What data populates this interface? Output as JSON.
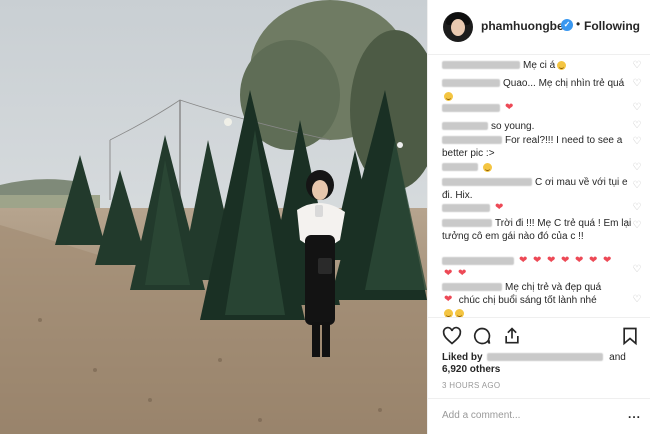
{
  "post": {
    "username": "phamhuongbee",
    "follow_label": "Following",
    "separator": "•"
  },
  "comments": [
    {
      "text": "Mẹ ci á",
      "emoji": "grinning-face"
    },
    {
      "text": "Quao... Mẹ chị nhìn trẻ quá",
      "emoji": "smiling-face"
    },
    {
      "text": "",
      "emoji": "red-heart"
    },
    {
      "text": "so young."
    },
    {
      "text": "For real?!!! I need to see a better pic :>"
    },
    {
      "text": "",
      "emoji": "smiling-face"
    },
    {
      "text": "C ơi mau về với tụi e đi. Hix."
    },
    {
      "text": "",
      "emoji": "red-heart"
    },
    {
      "text": "Trời đi !!! Mẹ C trẻ quá ! Em lại tưởng cô em gái nào đó của c !!"
    },
    {
      "text": "",
      "emoji": "red-heart x7"
    },
    {
      "text": "Mẹ chị trẻ và đẹp quá",
      "line2": "chúc chị buổi sáng tốt lành nhé"
    }
  ],
  "actions": {
    "liked_by_prefix": "Liked by",
    "liked_by_and": "and",
    "likes_count": "6,920 others",
    "time_ago": "3 HOURS AGO",
    "add_comment_placeholder": "Add a comment...",
    "more_label": "..."
  },
  "colors": {
    "accent_blue": "#3897f0",
    "heart_red": "#ed4956",
    "border": "#efefef",
    "muted_text": "#999999"
  }
}
